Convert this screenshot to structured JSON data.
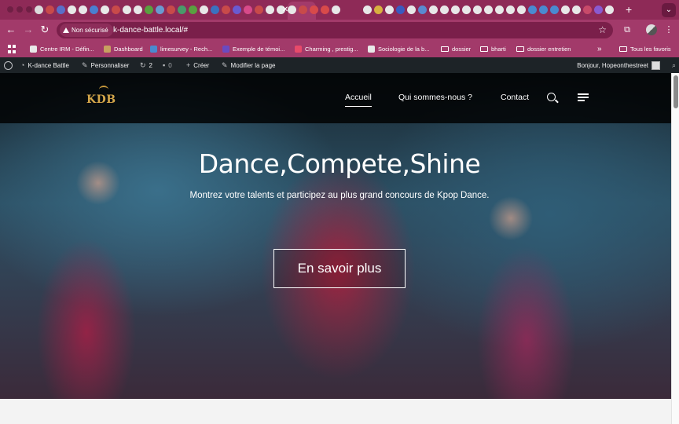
{
  "browser": {
    "tab_colors": [
      "#dcdcdc",
      "#c84a4a",
      "#5a6fc8",
      "#e8e8e8",
      "#e8e8e8",
      "#4a7fd0",
      "#e8e8e8",
      "#c84a4a",
      "#e8e8e8",
      "#e8e8e8",
      "#5aa040",
      "#6a9ad0",
      "#c84a4a",
      "#4a9a6a",
      "#5aa040",
      "#e8e8e8",
      "#3a72c0",
      "#c84a4a",
      "#6a5ad0",
      "#d84a8a",
      "#c84a4a",
      "#e8e8e8",
      "#e8e8e8",
      "#e8e8e8",
      "#c84a4a",
      "#d84a4a",
      "#d84a4a",
      "#e8e8e8",
      "#e8e8e8",
      "#d8b040",
      "#e8e8e8",
      "#3a5ac0",
      "#e8e8e8",
      "#5a8ad0",
      "#e8e8e8",
      "#e8e8e8",
      "#e8e8e8",
      "#e8e8e8",
      "#e8e8e8",
      "#e8e8e8",
      "#e8e8e8",
      "#e8e8e8",
      "#e8e8e8",
      "#4a8ad0",
      "#4a8ad0",
      "#4a8ad0",
      "#e8e8e8",
      "#e8e8e8",
      "#c84a6a",
      "#8a5ad0",
      "#e8e8e8"
    ],
    "new_tab_label": "+",
    "tab_menu_label": "⌄",
    "close_tab_label": "✕",
    "security_label": "Non sécurisé",
    "url": "k-dance-battle.local/#",
    "accent": "#a23a6a"
  },
  "bookmarks": {
    "items": [
      {
        "label": "Centre IRM - Défin...",
        "color": "#e8e8e8"
      },
      {
        "label": "Dashboard",
        "color": "#c8a060"
      },
      {
        "label": "limesurvey - Rech...",
        "color": "#4a8ad0"
      },
      {
        "label": "Exemple de témoi...",
        "color": "#6a4ac0"
      },
      {
        "label": "Charming , prestig...",
        "color": "#e84a6a"
      },
      {
        "label": "Sociologie de la b...",
        "color": "#e8e8e8"
      },
      {
        "label": "dossier",
        "folder": true
      },
      {
        "label": "bharti",
        "folder": true
      },
      {
        "label": "dossier entretien",
        "folder": true
      }
    ],
    "more_label": "»",
    "all_label": "Tous les favoris"
  },
  "wpbar": {
    "site_name": "K-dance Battle",
    "customize": "Personnaliser",
    "updates": "2",
    "comments": "0",
    "new": "Créer",
    "edit": "Modifier la page",
    "greeting": "Bonjour, Hopeonthestreet"
  },
  "site": {
    "logo_text": "KDB",
    "nav": [
      "Accueil",
      "Qui sommes-nous ?",
      "Contact"
    ],
    "hero_title": "Dance,Compete,Shine",
    "hero_subtitle": "Montrez votre talents et participez au plus grand concours de Kpop Dance.",
    "hero_button": "En savoir plus"
  }
}
